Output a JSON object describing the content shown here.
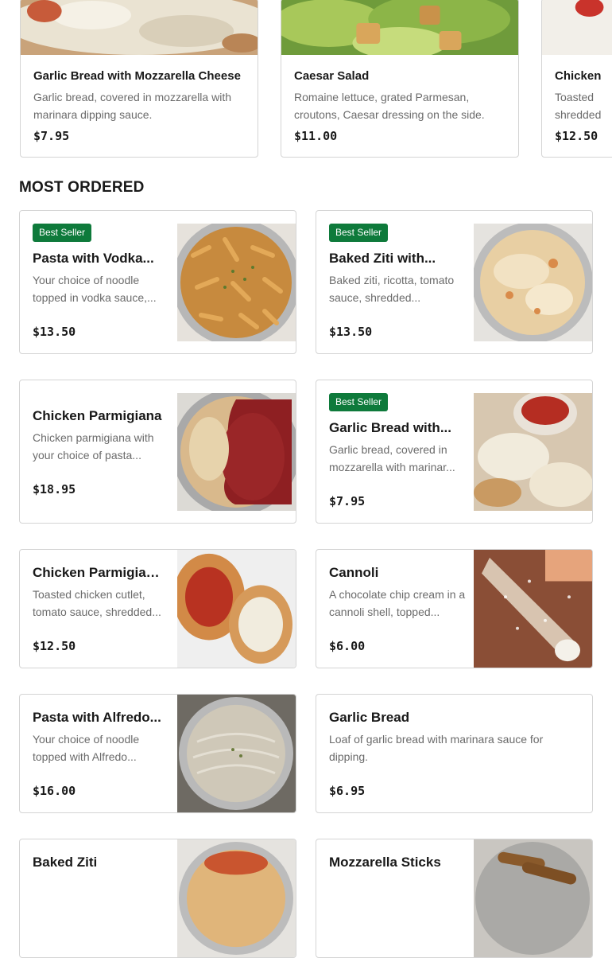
{
  "carousel": {
    "items": [
      {
        "title": "Garlic Bread with Mozzarella Cheese",
        "desc": "Garlic bread, covered in mozzarella with marinara dipping sauce.",
        "price": "$7.95"
      },
      {
        "title": "Caesar Salad",
        "desc": "Romaine lettuce, grated Parmesan, croutons, Caesar dressing on the side.",
        "price": "$11.00"
      },
      {
        "title": "Chicken",
        "desc": "Toasted shredded",
        "price": "$12.50"
      }
    ]
  },
  "section": {
    "title": "MOST ORDERED"
  },
  "badge_label": "Best Seller",
  "items": [
    {
      "title": "Pasta with Vodka...",
      "desc": "Your choice of noodle topped in vodka sauce,...",
      "price": "$13.50",
      "badge": true,
      "image": "penne-vodka-photo"
    },
    {
      "title": "Baked Ziti with...",
      "desc": "Baked ziti, ricotta, tomato sauce, shredded...",
      "price": "$13.50",
      "badge": true,
      "image": "baked-ziti-photo"
    },
    {
      "title": "Chicken Parmigiana",
      "desc": "Chicken parmigiana with your choice of pasta...",
      "price": "$18.95",
      "badge": false,
      "image": "chicken-parm-photo"
    },
    {
      "title": "Garlic Bread with...",
      "desc": "Garlic bread, covered in mozzarella with marinar...",
      "price": "$7.95",
      "badge": true,
      "image": "garlic-bread-photo"
    },
    {
      "title": "Chicken Parmigiano...",
      "desc": "Toasted chicken cutlet, tomato sauce, shredded...",
      "price": "$12.50",
      "badge": false,
      "image": "chicken-sub-photo"
    },
    {
      "title": "Cannoli",
      "desc": "A chocolate chip cream in a cannoli shell, topped...",
      "price": "$6.00",
      "badge": false,
      "image": "cannoli-photo"
    },
    {
      "title": "Pasta with Alfredo...",
      "desc": "Your choice of noodle topped with Alfredo...",
      "price": "$16.00",
      "badge": false,
      "image": "alfredo-photo"
    },
    {
      "title": "Garlic Bread",
      "desc": "Loaf of garlic bread with marinara sauce for dipping.",
      "price": "$6.95",
      "badge": false,
      "image": null
    },
    {
      "title": "Baked Ziti",
      "desc": "",
      "price": "",
      "badge": false,
      "image": "baked-ziti-photo"
    },
    {
      "title": "Mozzarella Sticks",
      "desc": "",
      "price": "",
      "badge": false,
      "image": "mozzarella-sticks-photo"
    }
  ],
  "colors": {
    "badge": "#0e7a3b",
    "border": "#d4d4d4",
    "muted_text": "#6b6b6b"
  }
}
